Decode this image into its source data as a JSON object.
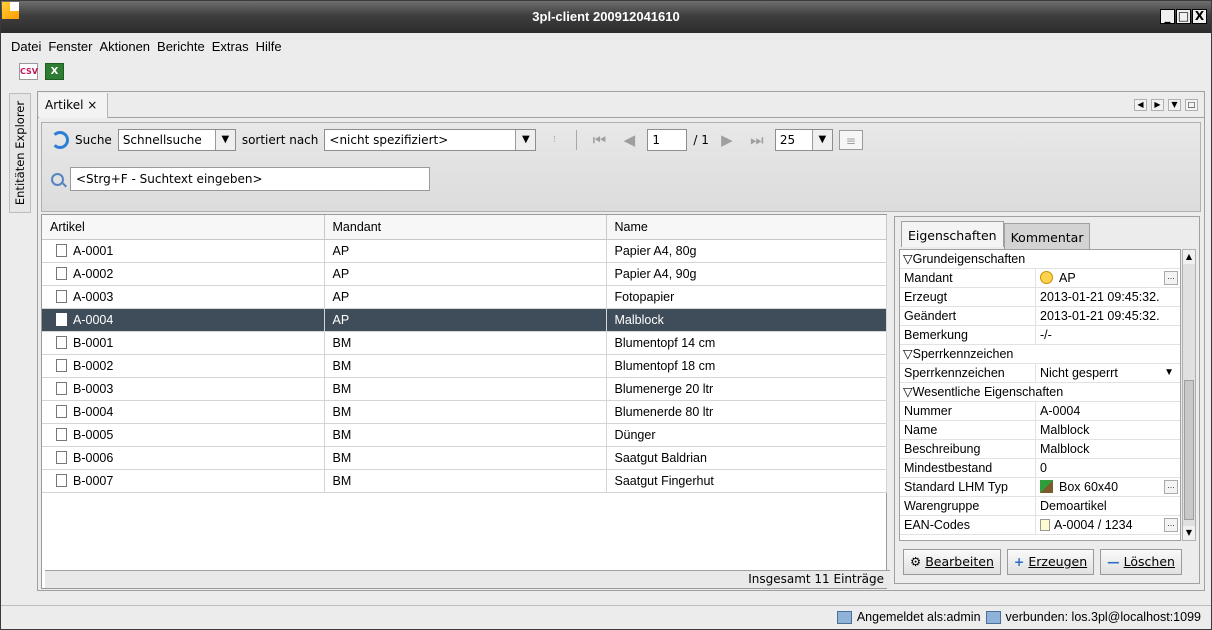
{
  "window": {
    "title": "3pl-client 200912041610",
    "buttons": [
      "_",
      "□",
      "X"
    ]
  },
  "menu": [
    "Datei",
    "Fenster",
    "Aktionen",
    "Berichte",
    "Extras",
    "Hilfe"
  ],
  "toolbar": {
    "csv_label": "CSV",
    "xls_label": "X"
  },
  "sidebar": {
    "tab_label": "Entitäten Explorer"
  },
  "tabs": {
    "active": "Artikel ×"
  },
  "search": {
    "label": "Suche",
    "mode": "Schnellsuche",
    "sort_label": "sortiert nach",
    "sort_value": "<nicht spezifiziert>",
    "page": "1",
    "page_total": "/ 1",
    "page_size": "25",
    "quick_placeholder": "<Strg+F - Suchtext eingeben>"
  },
  "table": {
    "columns": [
      "Artikel",
      "Mandant",
      "Name"
    ],
    "rows": [
      {
        "artikel": "A-0001",
        "mandant": "AP",
        "name": "Papier A4, 80g"
      },
      {
        "artikel": "A-0002",
        "mandant": "AP",
        "name": "Papier A4, 90g"
      },
      {
        "artikel": "A-0003",
        "mandant": "AP",
        "name": "Fotopapier"
      },
      {
        "artikel": "A-0004",
        "mandant": "AP",
        "name": "Malblock",
        "selected": true
      },
      {
        "artikel": "B-0001",
        "mandant": "BM",
        "name": "Blumentopf 14 cm"
      },
      {
        "artikel": "B-0002",
        "mandant": "BM",
        "name": "Blumentopf 18 cm"
      },
      {
        "artikel": "B-0003",
        "mandant": "BM",
        "name": "Blumenerge 20 ltr"
      },
      {
        "artikel": "B-0004",
        "mandant": "BM",
        "name": "Blumenerde 80 ltr"
      },
      {
        "artikel": "B-0005",
        "mandant": "BM",
        "name": "Dünger"
      },
      {
        "artikel": "B-0006",
        "mandant": "BM",
        "name": "Saatgut Baldrian"
      },
      {
        "artikel": "B-0007",
        "mandant": "BM",
        "name": "Saatgut Fingerhut"
      }
    ],
    "total": "Insgesamt 11 Einträge"
  },
  "props": {
    "tabs": [
      "Eigenschaften",
      "Kommentar"
    ],
    "groups": {
      "grund": "▽Grundeigenschaften",
      "sperr": "▽Sperrkennzeichen",
      "wesent": "▽Wesentliche Eigenschaften"
    },
    "rows": {
      "mandant": [
        "Mandant",
        "AP"
      ],
      "erzeugt": [
        "Erzeugt",
        "2013-01-21 09:45:32."
      ],
      "geaendert": [
        "Geändert",
        "2013-01-21 09:45:32."
      ],
      "bemerkung": [
        "Bemerkung",
        "-/-"
      ],
      "sperrkz": [
        "Sperrkennzeichen",
        "Nicht gesperrt"
      ],
      "nummer": [
        "Nummer",
        "A-0004"
      ],
      "name": [
        "Name",
        "Malblock"
      ],
      "beschreibung": [
        "Beschreibung",
        "Malblock"
      ],
      "mindest": [
        "Mindestbestand",
        "0"
      ],
      "lhm": [
        "Standard LHM Typ",
        "Box 60x40"
      ],
      "warengruppe": [
        "Warengruppe",
        "Demoartikel"
      ],
      "ean": [
        "EAN-Codes",
        "A-0004 / 1234"
      ]
    },
    "buttons": {
      "edit": "Bearbeiten",
      "create": "Erzeugen",
      "delete": "Löschen"
    }
  },
  "status": {
    "user": "Angemeldet als:admin",
    "connection": "verbunden: los.3pl@localhost:1099"
  }
}
